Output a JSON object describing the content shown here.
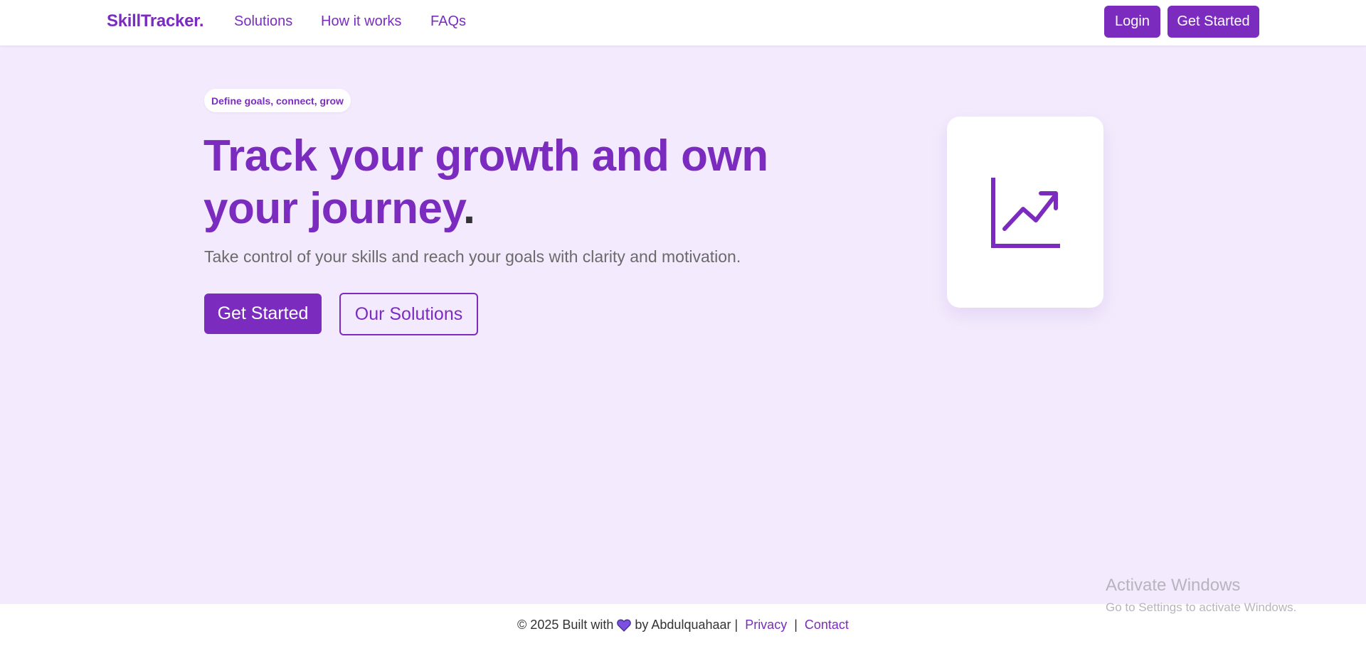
{
  "nav": {
    "brand": "SkillTracker.",
    "links": [
      "Solutions",
      "How it works",
      "FAQs"
    ],
    "login": "Login",
    "get_started": "Get Started"
  },
  "hero": {
    "badge": "Define goals, connect, grow",
    "title": "Track your growth and own your journey",
    "title_dot": ".",
    "subtitle": "Take control of your skills and reach your goals with clarity and motivation.",
    "primary_button": "Get Started",
    "secondary_button": "Our Solutions",
    "card_icon": "trending-up-chart-icon"
  },
  "footer": {
    "prefix": "© 2025 Built with",
    "heart_icon": "heart-icon",
    "suffix": "by Abdulquahaar |",
    "privacy": "Privacy",
    "separator": "|",
    "contact": "Contact"
  },
  "watermark": {
    "title": "Activate Windows",
    "subtitle": "Go to Settings to activate Windows."
  },
  "colors": {
    "accent": "#7b2cbf",
    "background": "#f3ebfd",
    "surface": "#ffffff"
  }
}
